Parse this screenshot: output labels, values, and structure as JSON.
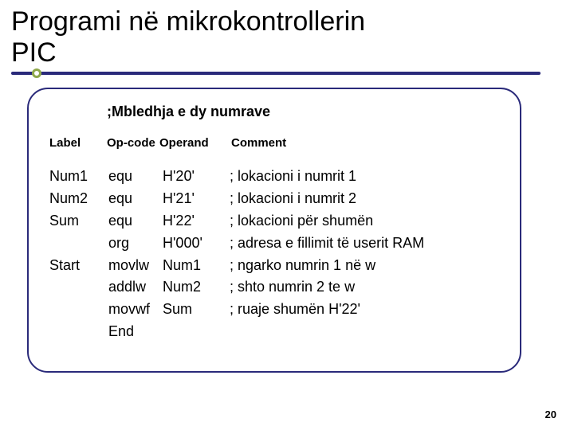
{
  "title_line1": "Programi në mikrokontrollerin",
  "title_line2": "PIC",
  "program_title": ";Mbledhja e dy numrave",
  "headers": {
    "label": "Label",
    "opcode": "Op-code",
    "operand": "Operand",
    "comment": "Comment"
  },
  "rows": [
    {
      "label": "Num1",
      "opcode": "equ",
      "operand": "H'20'",
      "comment": "; lokacioni i numrit 1"
    },
    {
      "label": "Num2",
      "opcode": "equ",
      "operand": "H'21'",
      "comment": "; lokacioni i numrit 2"
    },
    {
      "label": "Sum",
      "opcode": "equ",
      "operand": "H'22'",
      "comment": "; lokacioni për shumën"
    },
    {
      "label": "",
      "opcode": "org",
      "operand": "H'000'",
      "comment": "; adresa e fillimit të userit RAM"
    },
    {
      "label": "Start",
      "opcode": "movlw",
      "operand": "Num1",
      "comment": "; ngarko numrin 1 në w"
    },
    {
      "label": "",
      "opcode": "addlw",
      "operand": " Num2",
      "comment": "; shto numrin 2 te w"
    },
    {
      "label": "",
      "opcode": "movwf",
      "operand": "Sum",
      "comment": "; ruaje shumën H'22'"
    },
    {
      "label": "",
      "opcode": "End",
      "operand": "",
      "comment": ""
    }
  ],
  "page_number": "20"
}
